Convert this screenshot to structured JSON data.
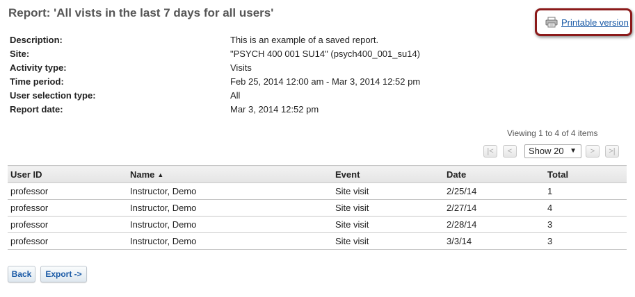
{
  "report": {
    "title": "Report: 'All vists in the last 7 days for all users'"
  },
  "printable": {
    "icon": "printer-icon",
    "label": "Printable version"
  },
  "meta": [
    {
      "label": "Description:",
      "value": "This is an example of a saved report."
    },
    {
      "label": "Site:",
      "value": "\"PSYCH 400 001 SU14\" (psych400_001_su14)"
    },
    {
      "label": "Activity type:",
      "value": "Visits"
    },
    {
      "label": "Time period:",
      "value": "Feb 25, 2014 12:00 am - Mar 3, 2014 12:52 pm"
    },
    {
      "label": "User selection type:",
      "value": "All"
    },
    {
      "label": "Report date:",
      "value": "Mar 3, 2014 12:52 pm"
    }
  ],
  "pager": {
    "viewing": "Viewing 1 to 4 of 4 items",
    "first": "|<",
    "prev": "<",
    "show": "Show 20",
    "next": ">",
    "last": ">|"
  },
  "table": {
    "headers": [
      "User ID",
      "Name",
      "Event",
      "Date",
      "Total"
    ],
    "rows": [
      [
        "professor",
        "Instructor, Demo",
        "Site visit",
        "2/25/14",
        "1"
      ],
      [
        "professor",
        "Instructor, Demo",
        "Site visit",
        "2/27/14",
        "4"
      ],
      [
        "professor",
        "Instructor, Demo",
        "Site visit",
        "2/28/14",
        "3"
      ],
      [
        "professor",
        "Instructor, Demo",
        "Site visit",
        "3/3/14",
        "3"
      ]
    ]
  },
  "buttons": {
    "back": "Back",
    "export": "Export ->"
  },
  "colors": {
    "link": "#1a5aa6",
    "highlight_border": "#8b1a1a"
  }
}
